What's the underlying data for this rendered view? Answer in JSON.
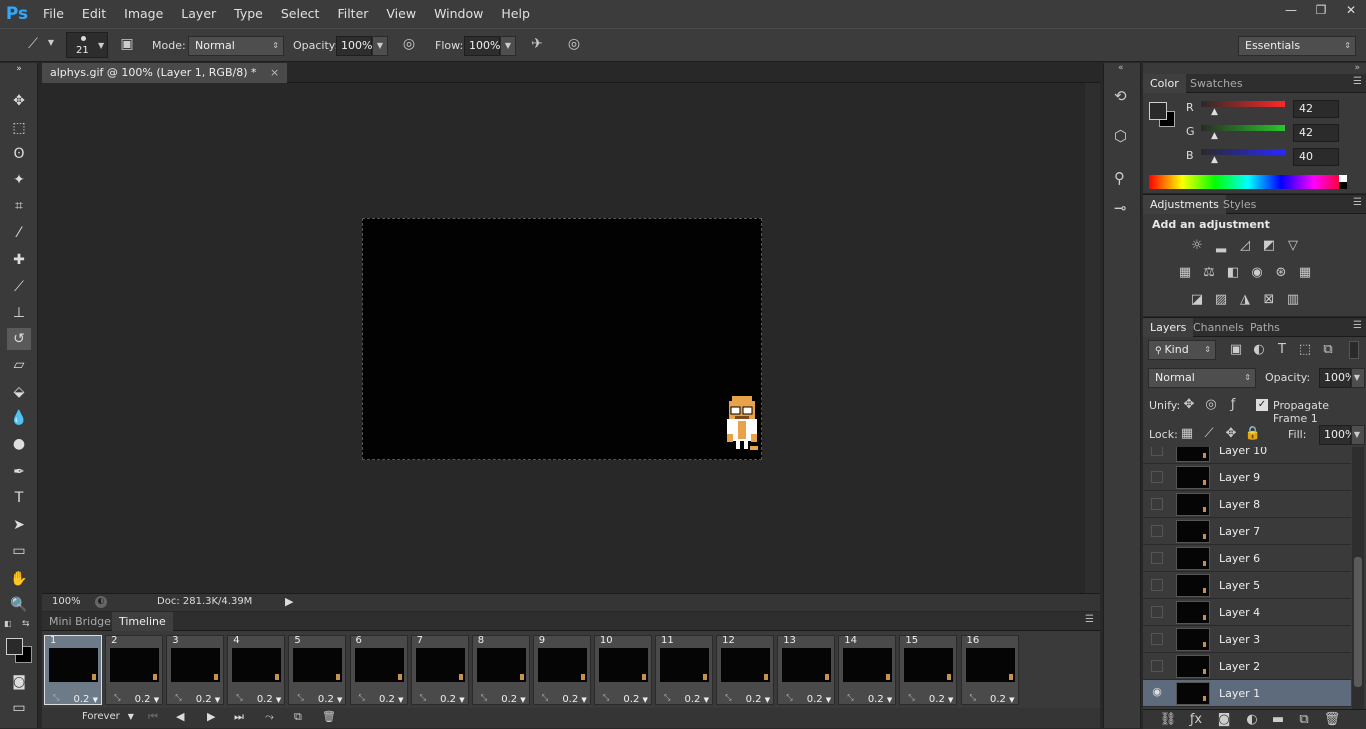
{
  "app": {
    "logo": "Ps"
  },
  "menu": [
    "File",
    "Edit",
    "Image",
    "Layer",
    "Type",
    "Select",
    "Filter",
    "View",
    "Window",
    "Help"
  ],
  "window_controls": [
    "—",
    "❐",
    "✕"
  ],
  "options": {
    "brush_size": "21",
    "mode_label": "Mode:",
    "mode_value": "Normal",
    "opacity_label": "Opacity:",
    "opacity_value": "100%",
    "flow_label": "Flow:",
    "flow_value": "100%",
    "workspace": "Essentials"
  },
  "document": {
    "tab_title": "alphys.gif @ 100% (Layer 1, RGB/8) *",
    "close": "×",
    "zoom": "100%",
    "doc_info": "Doc: 281.3K/4.39M"
  },
  "bottom_tabs": {
    "mini_bridge": "Mini Bridge",
    "timeline": "Timeline"
  },
  "timeline": {
    "frames": [
      {
        "num": "1",
        "delay": "0.2"
      },
      {
        "num": "2",
        "delay": "0.2"
      },
      {
        "num": "3",
        "delay": "0.2"
      },
      {
        "num": "4",
        "delay": "0.2"
      },
      {
        "num": "5",
        "delay": "0.2"
      },
      {
        "num": "6",
        "delay": "0.2"
      },
      {
        "num": "7",
        "delay": "0.2"
      },
      {
        "num": "8",
        "delay": "0.2"
      },
      {
        "num": "9",
        "delay": "0.2"
      },
      {
        "num": "10",
        "delay": "0.2"
      },
      {
        "num": "11",
        "delay": "0.2"
      },
      {
        "num": "12",
        "delay": "0.2"
      },
      {
        "num": "13",
        "delay": "0.2"
      },
      {
        "num": "14",
        "delay": "0.2"
      },
      {
        "num": "15",
        "delay": "0.2"
      },
      {
        "num": "16",
        "delay": "0.2"
      }
    ],
    "loop": "Forever",
    "selected_frame": "1"
  },
  "color_panel": {
    "tabs": [
      "Color",
      "Swatches"
    ],
    "r_label": "R",
    "r_value": "42",
    "g_label": "G",
    "g_value": "42",
    "b_label": "B",
    "b_value": "40"
  },
  "adjustments_panel": {
    "tabs": [
      "Adjustments",
      "Styles"
    ],
    "heading": "Add an adjustment"
  },
  "layers_panel": {
    "tabs": [
      "Layers",
      "Channels",
      "Paths"
    ],
    "filter_kind": "Kind",
    "blend_mode": "Normal",
    "opacity_label": "Opacity:",
    "opacity_value": "100%",
    "unify_label": "Unify:",
    "propagate_label": "Propagate Frame 1",
    "lock_label": "Lock:",
    "fill_label": "Fill:",
    "fill_value": "100%",
    "layers": [
      "Layer 10",
      "Layer 9",
      "Layer 8",
      "Layer 7",
      "Layer 6",
      "Layer 5",
      "Layer 4",
      "Layer 3",
      "Layer 2",
      "Layer 1"
    ],
    "selected_layer": "Layer 1"
  }
}
